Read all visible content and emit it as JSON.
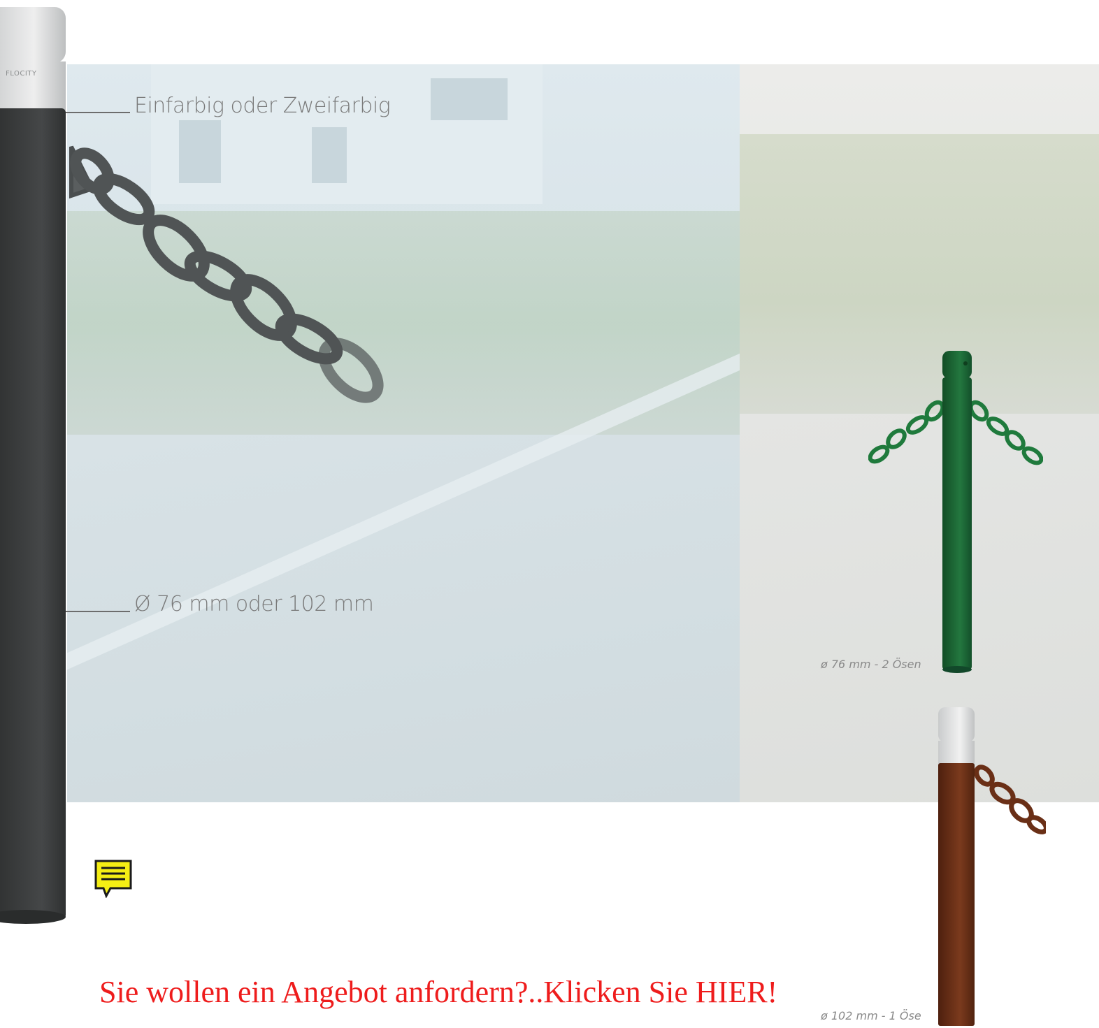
{
  "annotations": {
    "color_label": "Einfarbig oder Zweifarbig",
    "diameter_label": "Ø 76 mm oder 102 mm"
  },
  "variants": [
    {
      "caption": "ø 76 mm - 2 Ösen",
      "color": "#1f6b35"
    },
    {
      "caption": "ø 102 mm - 1 Öse",
      "color": "#6b2e17"
    }
  ],
  "main_bollard": {
    "brand_mark": "FLOCITY",
    "color": "#3d3f3f"
  },
  "cta": {
    "text": "Sie wollen ein Angebot anfordern?..Klicken Sie HIER!",
    "color": "#ee1c1c"
  },
  "icons": {
    "note": "sticky-note-icon"
  }
}
